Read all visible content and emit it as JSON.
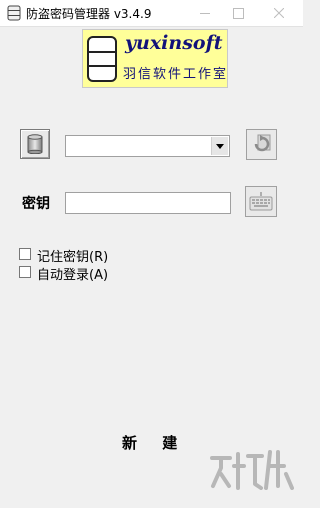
{
  "window": {
    "title": "防盗密码管理器 v3.4.9",
    "minimize_icon": "minimize-icon",
    "maximize_icon": "maximize-icon",
    "close_icon": "close-icon"
  },
  "logo": {
    "name": "yuxinsoft",
    "subtitle": "羽信软件工作室",
    "icon": "database-cylinder-icon",
    "background": "#ffff99",
    "text_color": "#12127a"
  },
  "database_row": {
    "db_button_icon": "database-icon",
    "select_value": "",
    "refresh_icon": "refresh-icon"
  },
  "key_row": {
    "label": "密钥",
    "input_value": "",
    "keyboard_icon": "keyboard-icon"
  },
  "options": {
    "remember_key": {
      "label": "记住密钥(R)",
      "checked": false
    },
    "auto_login": {
      "label": "自动登录(A)",
      "checked": false
    }
  },
  "actions": {
    "create_label": "新 建"
  }
}
